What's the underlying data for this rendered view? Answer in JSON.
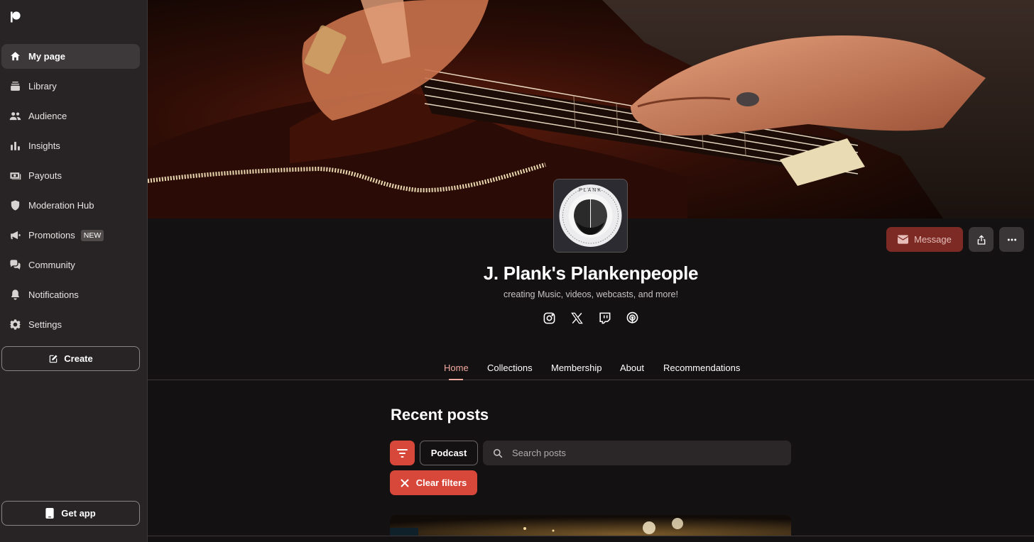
{
  "sidebar": {
    "items": [
      {
        "label": "My page",
        "icon": "home-icon",
        "active": true
      },
      {
        "label": "Library",
        "icon": "library-icon"
      },
      {
        "label": "Audience",
        "icon": "audience-icon"
      },
      {
        "label": "Insights",
        "icon": "insights-icon"
      },
      {
        "label": "Payouts",
        "icon": "payouts-icon"
      },
      {
        "label": "Moderation Hub",
        "icon": "shield-icon"
      },
      {
        "label": "Promotions",
        "icon": "megaphone-icon",
        "badge": "NEW"
      },
      {
        "label": "Community",
        "icon": "chat-icon"
      },
      {
        "label": "Notifications",
        "icon": "bell-icon"
      },
      {
        "label": "Settings",
        "icon": "gear-icon"
      }
    ],
    "create_label": "Create",
    "get_app_label": "Get app"
  },
  "profile": {
    "avatar_text": "PLANK",
    "name": "J. Plank's Plankenpeople",
    "tagline": "creating Music, videos, webcasts, and more!",
    "message_label": "Message",
    "socials": [
      "instagram-icon",
      "x-icon",
      "twitch-icon",
      "podcast-icon"
    ]
  },
  "tabs": [
    {
      "label": "Home",
      "active": true
    },
    {
      "label": "Collections"
    },
    {
      "label": "Membership"
    },
    {
      "label": "About"
    },
    {
      "label": "Recommendations"
    }
  ],
  "posts": {
    "heading": "Recent posts",
    "filter_chip": "Podcast",
    "search_placeholder": "Search posts",
    "clear_filters_label": "Clear filters"
  },
  "colors": {
    "accent": "#d7473a",
    "message_button": "#7e2a24",
    "active_tab": "#f2a99f",
    "sidebar_bg": "#282425",
    "page_bg": "#131112"
  }
}
